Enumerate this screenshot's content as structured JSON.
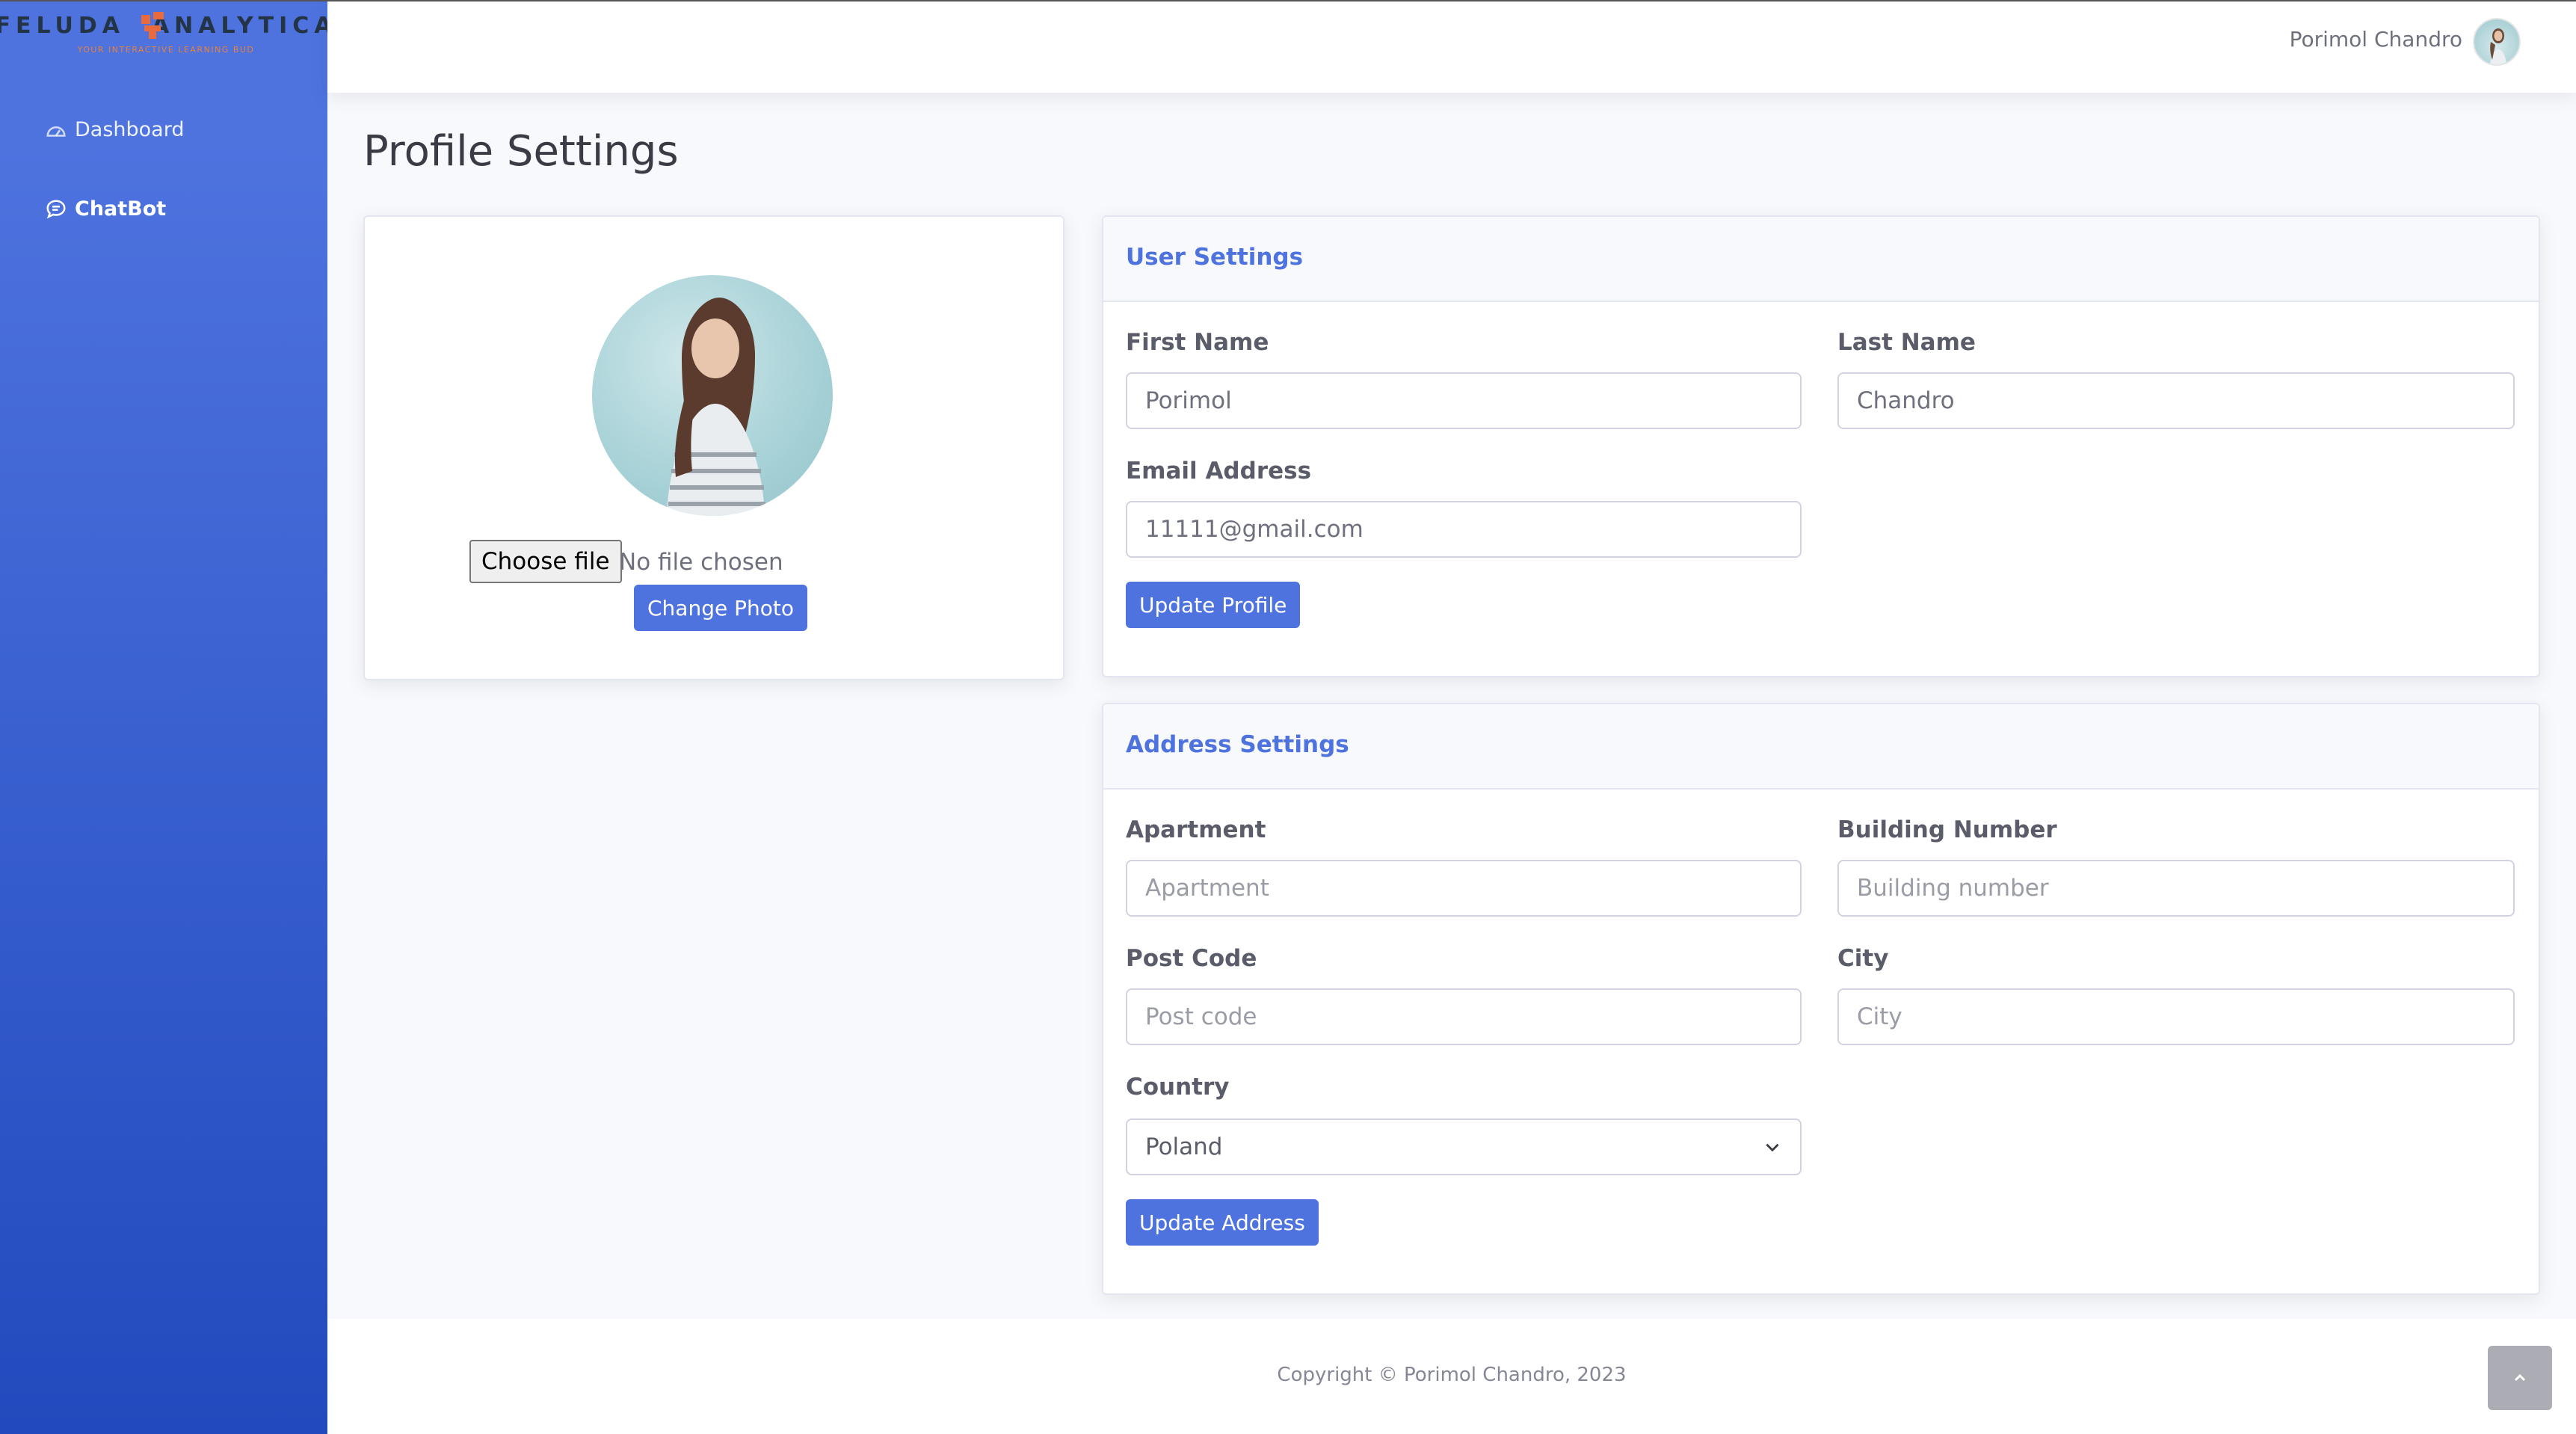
{
  "brand": {
    "name_left": "FELUDA",
    "name_right": "ANALYTICA",
    "tagline": "YOUR INTERACTIVE LEARNING BUD",
    "accent": "#e96a3c"
  },
  "sidebar": {
    "items": [
      {
        "label": "Dashboard",
        "icon": "gauge-icon"
      },
      {
        "label": "ChatBot",
        "icon": "chat-icon"
      }
    ]
  },
  "topbar": {
    "user_name": "Porimol Chandro"
  },
  "page": {
    "title": "Profile Settings"
  },
  "photo_card": {
    "file_button": "Choose file",
    "file_status": "No file chosen",
    "change_photo": "Change Photo"
  },
  "user_settings": {
    "title": "User Settings",
    "first_name": {
      "label": "First Name",
      "value": "Porimol"
    },
    "last_name": {
      "label": "Last Name",
      "value": "Chandro"
    },
    "email": {
      "label": "Email Address",
      "value": "11111@gmail.com"
    },
    "submit": "Update Profile"
  },
  "address_settings": {
    "title": "Address Settings",
    "apartment": {
      "label": "Apartment",
      "placeholder": "Apartment"
    },
    "building": {
      "label": "Building Number",
      "placeholder": "Building number"
    },
    "post_code": {
      "label": "Post Code",
      "placeholder": "Post code"
    },
    "city": {
      "label": "City",
      "placeholder": "City"
    },
    "country": {
      "label": "Country",
      "value": "Poland"
    },
    "submit": "Update Address"
  },
  "footer": {
    "copyright": "Copyright © Porimol Chandro, 2023"
  },
  "colors": {
    "primary": "#4e73df",
    "sidebar_bottom": "#224abe",
    "background": "#f8f9fc"
  }
}
